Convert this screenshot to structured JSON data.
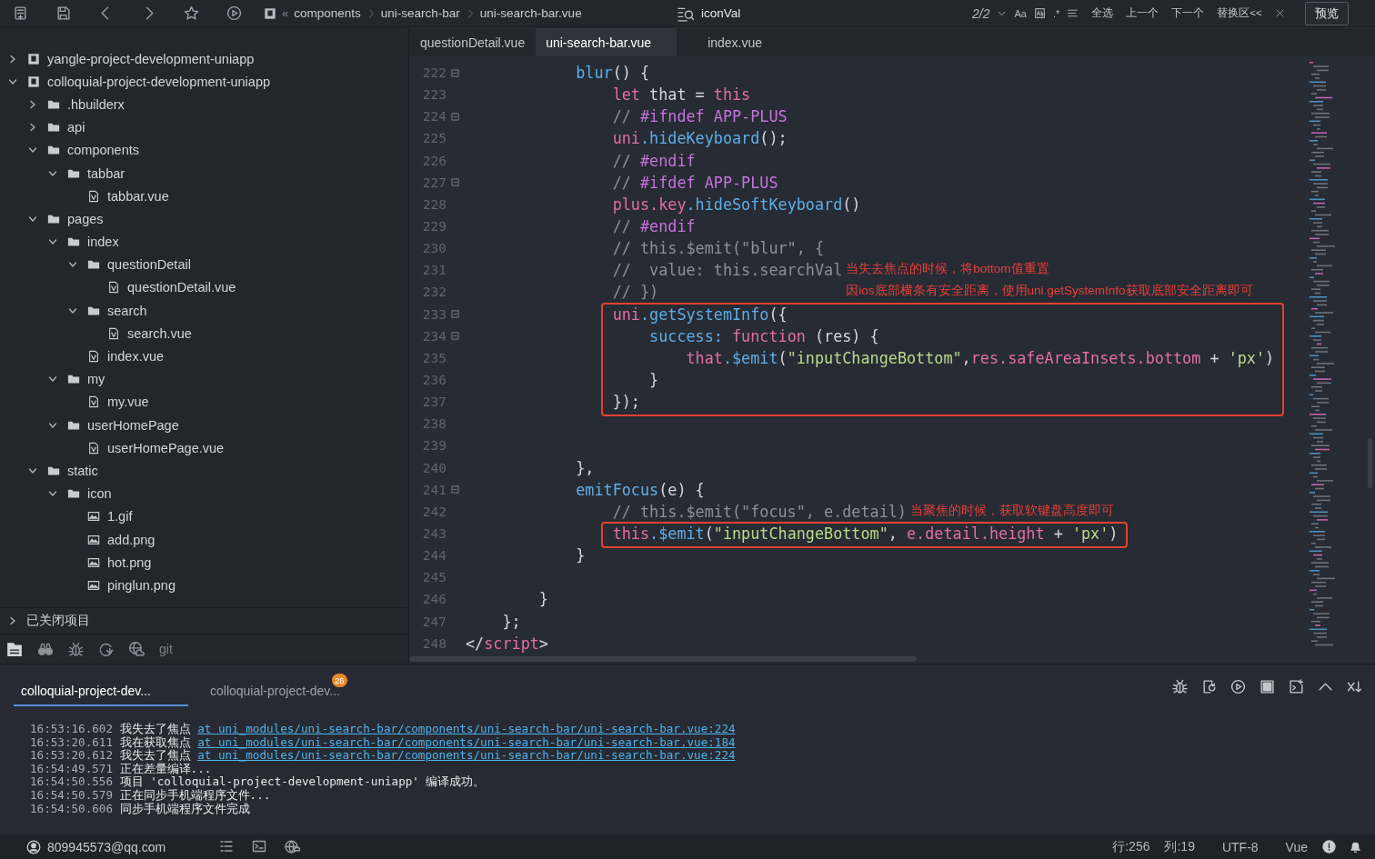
{
  "toolbar": {
    "breadcrumb_prefix": "«",
    "breadcrumb": [
      "components",
      "uni-search-bar",
      "uni-search-bar.vue"
    ],
    "search": {
      "value": "iconVal",
      "match_count": "2/2",
      "case_option": "Aa",
      "regex_option": ".*",
      "actions": [
        "全选",
        "上一个",
        "下一个",
        "替换区<<"
      ]
    },
    "preview_button": "预览"
  },
  "sidebar": {
    "tree": [
      {
        "label": "yangle-project-development-uniapp",
        "kind": "project",
        "expanded": false
      },
      {
        "label": "colloquial-project-development-uniapp",
        "kind": "project",
        "expanded": true,
        "children": [
          {
            "label": ".hbuilderx",
            "kind": "folder",
            "expanded": false
          },
          {
            "label": "api",
            "kind": "folder",
            "expanded": false
          },
          {
            "label": "components",
            "kind": "folder",
            "expanded": true,
            "children": [
              {
                "label": "tabbar",
                "kind": "folder",
                "expanded": true,
                "children": [
                  {
                    "label": "tabbar.vue",
                    "kind": "file"
                  }
                ]
              }
            ]
          },
          {
            "label": "pages",
            "kind": "folder",
            "expanded": true,
            "children": [
              {
                "label": "index",
                "kind": "folder",
                "expanded": true,
                "children": [
                  {
                    "label": "questionDetail",
                    "kind": "folder",
                    "expanded": true,
                    "children": [
                      {
                        "label": "questionDetail.vue",
                        "kind": "file"
                      }
                    ]
                  },
                  {
                    "label": "search",
                    "kind": "folder",
                    "expanded": true,
                    "children": [
                      {
                        "label": "search.vue",
                        "kind": "file"
                      }
                    ]
                  },
                  {
                    "label": "index.vue",
                    "kind": "file"
                  }
                ]
              },
              {
                "label": "my",
                "kind": "folder",
                "expanded": true,
                "children": [
                  {
                    "label": "my.vue",
                    "kind": "file"
                  }
                ]
              },
              {
                "label": "userHomePage",
                "kind": "folder",
                "expanded": true,
                "children": [
                  {
                    "label": "userHomePage.vue",
                    "kind": "file"
                  }
                ]
              }
            ]
          },
          {
            "label": "static",
            "kind": "folder",
            "expanded": true,
            "children": [
              {
                "label": "icon",
                "kind": "folder",
                "expanded": true,
                "children": [
                  {
                    "label": "1.gif",
                    "kind": "image"
                  },
                  {
                    "label": "add.png",
                    "kind": "image"
                  },
                  {
                    "label": "hot.png",
                    "kind": "image"
                  },
                  {
                    "label": "pinglun.png",
                    "kind": "image"
                  }
                ]
              }
            ]
          }
        ]
      }
    ],
    "closed_projects": {
      "label": "已关闭项目",
      "expanded": false
    },
    "bottom_tool": "git"
  },
  "editor": {
    "tabs": [
      {
        "label": "questionDetail.vue",
        "selected": false
      },
      {
        "label": "uni-search-bar.vue",
        "selected": true
      },
      {
        "label": "index.vue",
        "selected": false
      }
    ],
    "lines": [
      {
        "number": "222",
        "fold": true,
        "tokens": [
          {
            "kind": "fn",
            "text": "            blur"
          },
          {
            "kind": "plain",
            "text": "() {"
          }
        ]
      },
      {
        "number": "223",
        "fold": false,
        "tokens": [
          {
            "kind": "kw",
            "text": "                let"
          },
          {
            "kind": "plain",
            "text": " that = "
          },
          {
            "kind": "kw",
            "text": "this"
          }
        ]
      },
      {
        "number": "224",
        "fold": true,
        "tokens": [
          {
            "kind": "cm",
            "text": "                // "
          },
          {
            "kind": "pre",
            "text": "#ifndef APP-PLUS"
          }
        ]
      },
      {
        "number": "225",
        "fold": false,
        "tokens": [
          {
            "kind": "var",
            "text": "                uni"
          },
          {
            "kind": "fn",
            "text": ".hideKeyboard"
          },
          {
            "kind": "plain",
            "text": "();"
          }
        ]
      },
      {
        "number": "226",
        "fold": false,
        "tokens": [
          {
            "kind": "cm",
            "text": "                // "
          },
          {
            "kind": "pre",
            "text": "#endif"
          }
        ]
      },
      {
        "number": "227",
        "fold": true,
        "tokens": [
          {
            "kind": "cm",
            "text": "                // "
          },
          {
            "kind": "pre",
            "text": "#ifdef APP-PLUS"
          }
        ]
      },
      {
        "number": "228",
        "fold": false,
        "tokens": [
          {
            "kind": "var",
            "text": "                plus"
          },
          {
            "kind": "var",
            "text": ".key"
          },
          {
            "kind": "fn",
            "text": ".hideSoftKeyboard"
          },
          {
            "kind": "plain",
            "text": "()"
          }
        ]
      },
      {
        "number": "229",
        "fold": false,
        "tokens": [
          {
            "kind": "cm",
            "text": "                // "
          },
          {
            "kind": "pre",
            "text": "#endif"
          }
        ]
      },
      {
        "number": "230",
        "fold": false,
        "tokens": [
          {
            "kind": "cm",
            "text": "                // this.$emit(\"blur\", {"
          }
        ]
      },
      {
        "number": "231",
        "fold": false,
        "tokens": [
          {
            "kind": "cm",
            "text": "                //  value: this.searchVal"
          }
        ],
        "note": "当失去焦点的时候，将bottom值重置"
      },
      {
        "number": "232",
        "fold": false,
        "tokens": [
          {
            "kind": "cm",
            "text": "                // })"
          }
        ],
        "note": "因ios底部横条有安全距离，使用uni.getSystemInfo获取底部安全距离即可"
      },
      {
        "number": "233",
        "fold": true,
        "boxed": true,
        "tokens": [
          {
            "kind": "var",
            "text": "                uni"
          },
          {
            "kind": "fn",
            "text": ".getSystemInfo"
          },
          {
            "kind": "plain",
            "text": "({"
          }
        ]
      },
      {
        "number": "234",
        "fold": true,
        "boxed": true,
        "tokens": [
          {
            "kind": "fn",
            "text": "                    success:"
          },
          {
            "kind": "kw",
            "text": " function"
          },
          {
            "kind": "plain",
            "text": " (res) {"
          }
        ]
      },
      {
        "number": "235",
        "fold": false,
        "boxed": true,
        "tokens": [
          {
            "kind": "var",
            "text": "                        that"
          },
          {
            "kind": "fn",
            "text": ".$emit"
          },
          {
            "kind": "plain",
            "text": "("
          },
          {
            "kind": "str",
            "text": "\"inputChangeBottom\""
          },
          {
            "kind": "plain",
            "text": ","
          },
          {
            "kind": "var",
            "text": "res"
          },
          {
            "kind": "var",
            "text": ".safeAreaInsets"
          },
          {
            "kind": "var",
            "text": ".bottom"
          },
          {
            "kind": "plain",
            "text": " + "
          },
          {
            "kind": "str",
            "text": "'px'"
          },
          {
            "kind": "plain",
            "text": ")"
          }
        ]
      },
      {
        "number": "236",
        "fold": false,
        "boxed": true,
        "tokens": [
          {
            "kind": "plain",
            "text": "                    }"
          }
        ]
      },
      {
        "number": "237",
        "fold": false,
        "boxed": true,
        "tokens": [
          {
            "kind": "plain",
            "text": "                });"
          }
        ]
      },
      {
        "number": "238",
        "fold": false
      },
      {
        "number": "239",
        "fold": false
      },
      {
        "number": "240",
        "fold": false,
        "tokens": [
          {
            "kind": "plain",
            "text": "            },"
          }
        ]
      },
      {
        "number": "241",
        "fold": true,
        "tokens": [
          {
            "kind": "fn",
            "text": "            emitFocus"
          },
          {
            "kind": "plain",
            "text": "(e) {"
          }
        ]
      },
      {
        "number": "242",
        "fold": false,
        "tokens": [
          {
            "kind": "cm",
            "text": "                // this.$emit(\"focus\", e.detail)"
          }
        ],
        "note": "当聚焦的时候，获取软键盘高度即可"
      },
      {
        "number": "243",
        "fold": false,
        "boxed": true,
        "tokens": [
          {
            "kind": "kw",
            "text": "                this"
          },
          {
            "kind": "fn",
            "text": ".$emit"
          },
          {
            "kind": "plain",
            "text": "("
          },
          {
            "kind": "str",
            "text": "\"inputChangeBottom\""
          },
          {
            "kind": "plain",
            "text": ", "
          },
          {
            "kind": "var",
            "text": "e"
          },
          {
            "kind": "var",
            "text": ".detail"
          },
          {
            "kind": "var",
            "text": ".height"
          },
          {
            "kind": "plain",
            "text": " + "
          },
          {
            "kind": "str",
            "text": "'px'"
          },
          {
            "kind": "plain",
            "text": ")"
          }
        ]
      },
      {
        "number": "244",
        "fold": false,
        "tokens": [
          {
            "kind": "plain",
            "text": "            }"
          }
        ]
      },
      {
        "number": "245",
        "fold": false
      },
      {
        "number": "246",
        "fold": false,
        "tokens": [
          {
            "kind": "plain",
            "text": "        }"
          }
        ]
      },
      {
        "number": "247",
        "fold": false,
        "tokens": [
          {
            "kind": "plain",
            "text": "    };"
          }
        ]
      },
      {
        "number": "248",
        "fold": false,
        "tokens": [
          {
            "kind": "plain",
            "text": "</"
          },
          {
            "kind": "var",
            "text": "script"
          },
          {
            "kind": "plain",
            "text": ">"
          }
        ]
      }
    ]
  },
  "console": {
    "tabs": [
      {
        "label": "colloquial-project-dev...",
        "selected": true
      },
      {
        "label": "colloquial-project-dev...",
        "selected": false,
        "badge": "26"
      }
    ],
    "lines": [
      {
        "time": "16:53:16.602",
        "message": "我失去了焦点",
        "link": "at uni_modules/uni-search-bar/components/uni-search-bar/uni-search-bar.vue:224"
      },
      {
        "time": "16:53:20.611",
        "message": "我在获取焦点",
        "link": "at uni_modules/uni-search-bar/components/uni-search-bar/uni-search-bar.vue:184"
      },
      {
        "time": "16:53:20.612",
        "message": "我失去了焦点",
        "link": "at uni_modules/uni-search-bar/components/uni-search-bar/uni-search-bar.vue:224"
      },
      {
        "time": "16:54:49.571",
        "message": "正在差量编译..."
      },
      {
        "time": "16:54:50.556",
        "message": "项目 'colloquial-project-development-uniapp' 编译成功。"
      },
      {
        "time": "16:54:50.579",
        "message": "正在同步手机端程序文件..."
      },
      {
        "time": "16:54:50.606",
        "message": "同步手机端程序文件完成"
      }
    ]
  },
  "status_bar": {
    "account": "809945573@qq.com",
    "line": "行:256",
    "column": "列:19",
    "encoding": "UTF-8",
    "language": "Vue"
  }
}
